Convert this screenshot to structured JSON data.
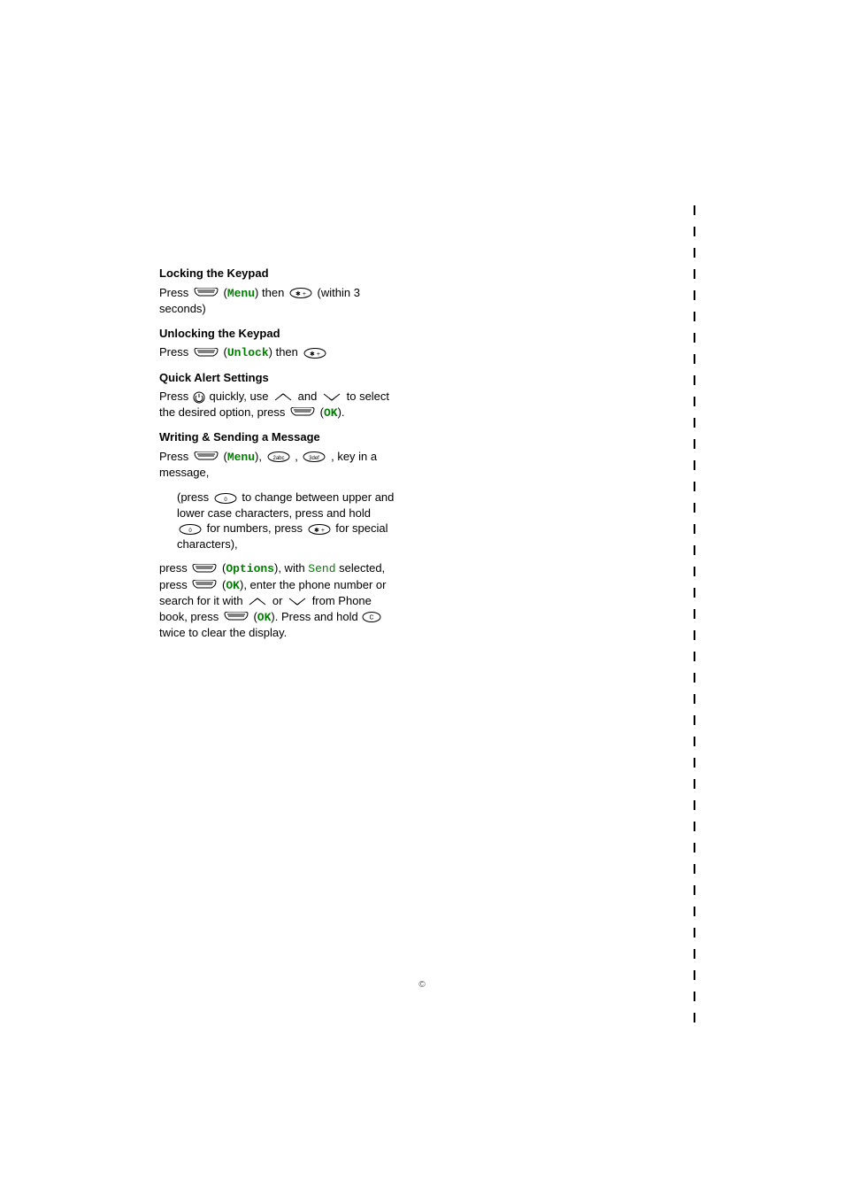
{
  "sections": {
    "lock": {
      "heading": "Locking the Keypad",
      "press": "Press ",
      "menu_label": "Menu",
      "then": " then ",
      "tail": " (within 3 seconds)"
    },
    "unlock": {
      "heading": "Unlocking the Keypad",
      "press": "Press ",
      "unlock_label": "Unlock",
      "then": " then "
    },
    "alert": {
      "heading": "Quick Alert Settings",
      "p1a": "Press ",
      "p1b": " quickly, use ",
      "p1c": " and ",
      "p1d": " to select the desired option, press ",
      "ok_label": "OK",
      "p1e": "."
    },
    "msg": {
      "heading": "Writing & Sending a Message",
      "l1a": "Press ",
      "menu_label": "Menu",
      "l1b": ", ",
      "l1c": ", ",
      "l1d": ", key in a message,",
      "sub_a": "(press ",
      "sub_b": " to change between upper and lower case characters, press and hold ",
      "sub_c": " for numbers, press ",
      "sub_d": " for special characters),",
      "l2a": "press ",
      "options_label": "Options",
      "l2b": ", with ",
      "send_label": "Send",
      "l2c": " selected, press ",
      "ok1": "OK",
      "l2d": ", enter the phone number or search for it with ",
      "l2e": " or ",
      "l2f": " from Phone book, press ",
      "ok2": "OK",
      "l2g": ". Press and hold ",
      "l2h": " twice to clear the display."
    }
  },
  "keys": {
    "two": "2 abc",
    "three": "3 def",
    "zero": "0",
    "star": "*"
  },
  "footer": "©"
}
